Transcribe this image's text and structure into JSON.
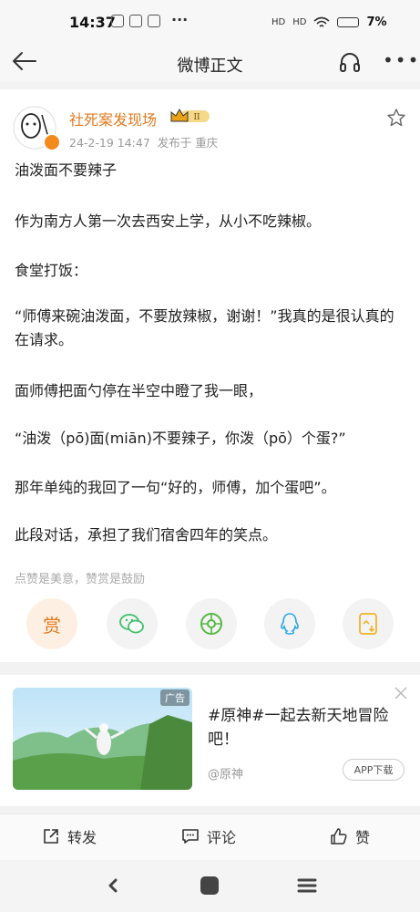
{
  "status_bar": {
    "time": "14:37",
    "more": "···",
    "battery": "7%",
    "hd1": "HD",
    "hd2": "HD"
  },
  "nav": {
    "title": "微博正文"
  },
  "post": {
    "author": "社死案发现场",
    "member_level": "II",
    "date": "24-2-19 14:47",
    "published_from": "发布于 重庆",
    "paragraphs": [
      "油泼面不要辣子",
      "作为南方人第一次去西安上学，从小不吃辣椒。",
      "食堂打饭：",
      "“师傅来碗油泼面，不要放辣椒，谢谢！”我真的是很认真的在请求。",
      "面师傅把面勺停在半空中瞪了我一眼，",
      "“油泼（pō)面(miān)不要辣子，你泼（pō）个蛋?”",
      "那年单纯的我回了一句“好的，师傅，加个蛋吧”。",
      "此段对话，承担了我们宿舍四年的笑点。"
    ],
    "reward_hint": "点赞是美意，赞赏是鼓励",
    "reward_label": "赏"
  },
  "ad": {
    "tag": "广告",
    "title": "#原神#一起去新天地冒险吧！",
    "source": "@原神",
    "button": "APP下载"
  },
  "actions": {
    "repost": "转发",
    "comment": "评论",
    "like": "赞"
  },
  "colors": {
    "accent": "#e07a1f",
    "wechat": "#3fbf6a",
    "moments": "#57b843",
    "qq": "#2aa7e4",
    "save": "#f0b429"
  }
}
